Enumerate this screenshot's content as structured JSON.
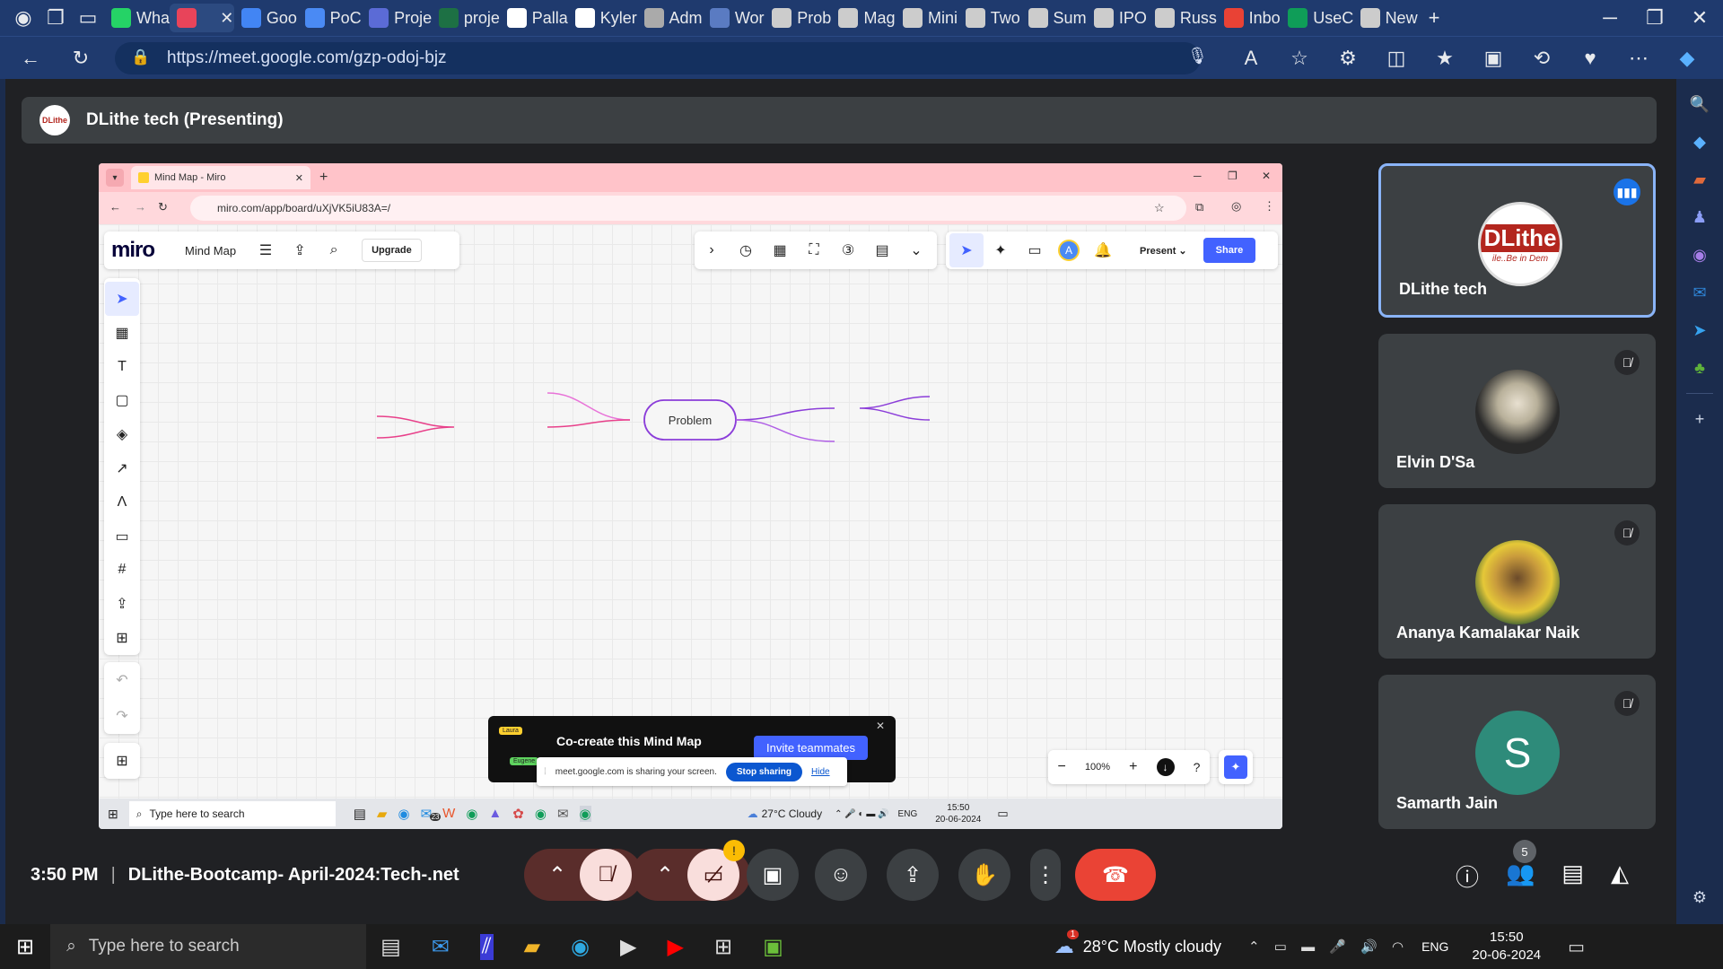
{
  "browser": {
    "tabs": [
      {
        "label": "Wha",
        "icon": "whatsapp-icon",
        "color": "#25d366"
      },
      {
        "label": "",
        "icon": "record-icon",
        "color": "#e8445a",
        "active": true
      },
      {
        "label": "Goo",
        "icon": "google-icon",
        "color": "#4285f4"
      },
      {
        "label": "PoC",
        "icon": "doc-icon",
        "color": "#4a8af4"
      },
      {
        "label": "Proje",
        "icon": "sheet-icon",
        "color": "#5b6bd6"
      },
      {
        "label": "proje",
        "icon": "excel-icon",
        "color": "#1d7044"
      },
      {
        "label": "Palla",
        "icon": "github-icon",
        "color": "#ffffff"
      },
      {
        "label": "Kyler",
        "icon": "github-icon",
        "color": "#ffffff"
      },
      {
        "label": "Adm",
        "icon": "admin-icon",
        "color": "#aaaaaa"
      },
      {
        "label": "Wor",
        "icon": "word-icon",
        "color": "#5a7bc2"
      },
      {
        "label": "Prob",
        "icon": "miro-icon",
        "color": "#cccccc"
      },
      {
        "label": "Mag",
        "icon": "miro-icon",
        "color": "#cccccc"
      },
      {
        "label": "Mini",
        "icon": "miro-icon",
        "color": "#cccccc"
      },
      {
        "label": "Two",
        "icon": "miro-icon",
        "color": "#cccccc"
      },
      {
        "label": "Sum",
        "icon": "miro-icon",
        "color": "#cccccc"
      },
      {
        "label": "IPO",
        "icon": "miro-icon",
        "color": "#cccccc"
      },
      {
        "label": "Russ",
        "icon": "miro-icon",
        "color": "#cccccc"
      },
      {
        "label": "Inbo",
        "icon": "gmail-icon",
        "color": "#e94235"
      },
      {
        "label": "UseC",
        "icon": "sheets-icon",
        "color": "#0f9d58"
      },
      {
        "label": "New",
        "icon": "newtab-icon",
        "color": "#cccccc"
      }
    ],
    "url": "https://meet.google.com/gzp-odoj-bjz"
  },
  "meet": {
    "presenting_title": "DLithe tech (Presenting)",
    "logo_text": "DLithe",
    "participants": [
      {
        "name": "DLithe tech",
        "avatar_text": "DLithe",
        "tagline": "ile..Be in Dem",
        "speaking": true
      },
      {
        "name": "Elvin D'Sa",
        "muted": true
      },
      {
        "name": "Ananya Kamalakar Naik",
        "muted": true
      },
      {
        "name": "Samarth Jain",
        "initial": "S",
        "avatar_color": "#2e8b7a",
        "muted": true
      }
    ],
    "time": "3:50 PM",
    "separator": "|",
    "meeting_name": "DLithe-Bootcamp- April-2024:Tech-.net",
    "people_count": "5"
  },
  "shared": {
    "tab_title": "Mind Map - Miro",
    "url": "miro.com/app/board/uXjVK5iU83A=/",
    "miro": {
      "logo": "miro",
      "board_name": "Mind Map",
      "upgrade": "Upgrade",
      "present": "Present",
      "share": "Share",
      "avatar_letter": "A",
      "zoom": "100%",
      "node": "Problem",
      "popup_title": "Co-create this Mind Map",
      "popup_button": "Invite teammates",
      "popup_tag1": "Laura",
      "popup_tag2": "Eugene",
      "sharing_text": "meet.google.com is sharing your screen.",
      "stop_sharing": "Stop sharing",
      "hide": "Hide"
    },
    "taskbar": {
      "search": "Type here to search",
      "weather": "27°C  Cloudy",
      "lang": "ENG",
      "time": "15:50",
      "date": "20-06-2024",
      "mail_badge": "23"
    }
  },
  "windows": {
    "search": "Type here to search",
    "weather": "28°C  Mostly cloudy",
    "weather_badge": "1",
    "lang": "ENG",
    "time": "15:50",
    "date": "20-06-2024"
  },
  "colors": {
    "accent": "#1a73e8",
    "end_call": "#ea4335",
    "miro_share": "#4262ff"
  }
}
